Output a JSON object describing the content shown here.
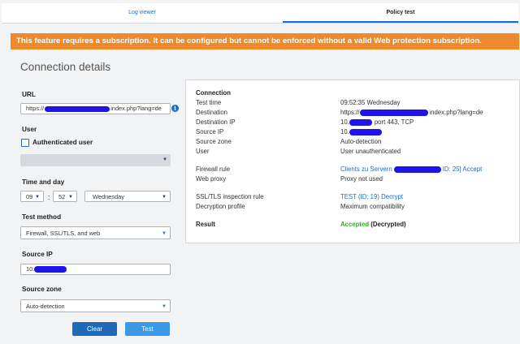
{
  "tabs": [
    {
      "label": "Log viewer"
    },
    {
      "label": "Policy test"
    }
  ],
  "banner": {
    "text": "This feature requires a subscription. It can be configured but cannot be enforced without a valid Web protection subscription."
  },
  "page_title": "Connection details",
  "form": {
    "url_label": "URL",
    "url_prefix": "https://",
    "url_suffix": "index.php?lang=de",
    "user_label": "User",
    "authenticated_user_label": "Authenticated user",
    "time_label": "Time and day",
    "hour": "09",
    "minute": "52",
    "day": "Wednesday",
    "test_method_label": "Test method",
    "test_method": "Firewall, SSL/TLS, and web",
    "source_ip_label": "Source IP",
    "source_ip_prefix": "10.",
    "source_zone_label": "Source zone",
    "source_zone": "Auto-detection",
    "clear_label": "Clear",
    "test_label": "Test"
  },
  "result": {
    "section_title": "Connection",
    "rows": [
      {
        "label": "Test time",
        "value": "09:52:35 Wednesday"
      },
      {
        "label": "Destination",
        "value_prefix": "https://",
        "value_suffix": "index.php?lang=de"
      },
      {
        "label": "Destination IP",
        "value_prefix": "10.",
        "value_suffix": "port 443, TCP"
      },
      {
        "label": "Source IP",
        "value_prefix": "10."
      },
      {
        "label": "Source zone",
        "value": "Auto-detection"
      },
      {
        "label": "User",
        "value": "User unauthenticated"
      },
      {
        "label": "Firewall rule",
        "value_prefix": "Clients zu Servern",
        "value_suffix": "ID: 25] Accept"
      },
      {
        "label": "Web proxy",
        "value": "Proxy not used"
      },
      {
        "label": "SSL/TLS inspection rule",
        "value": "TEST (ID: 19) Decrypt"
      },
      {
        "label": "Decryption profile",
        "value": "Maximum compatibility"
      },
      {
        "label": "Result",
        "value_accepted": "Accepted",
        "value_decrypted": "(Decrypted)"
      }
    ]
  },
  "icons": {
    "info": "info-icon",
    "caret": "chevron-down-icon"
  },
  "colors": {
    "accent": "#1a6dcc",
    "banner": "#ef8a2c",
    "accepted": "#3aa52f",
    "redaction": "#1e13ea"
  }
}
